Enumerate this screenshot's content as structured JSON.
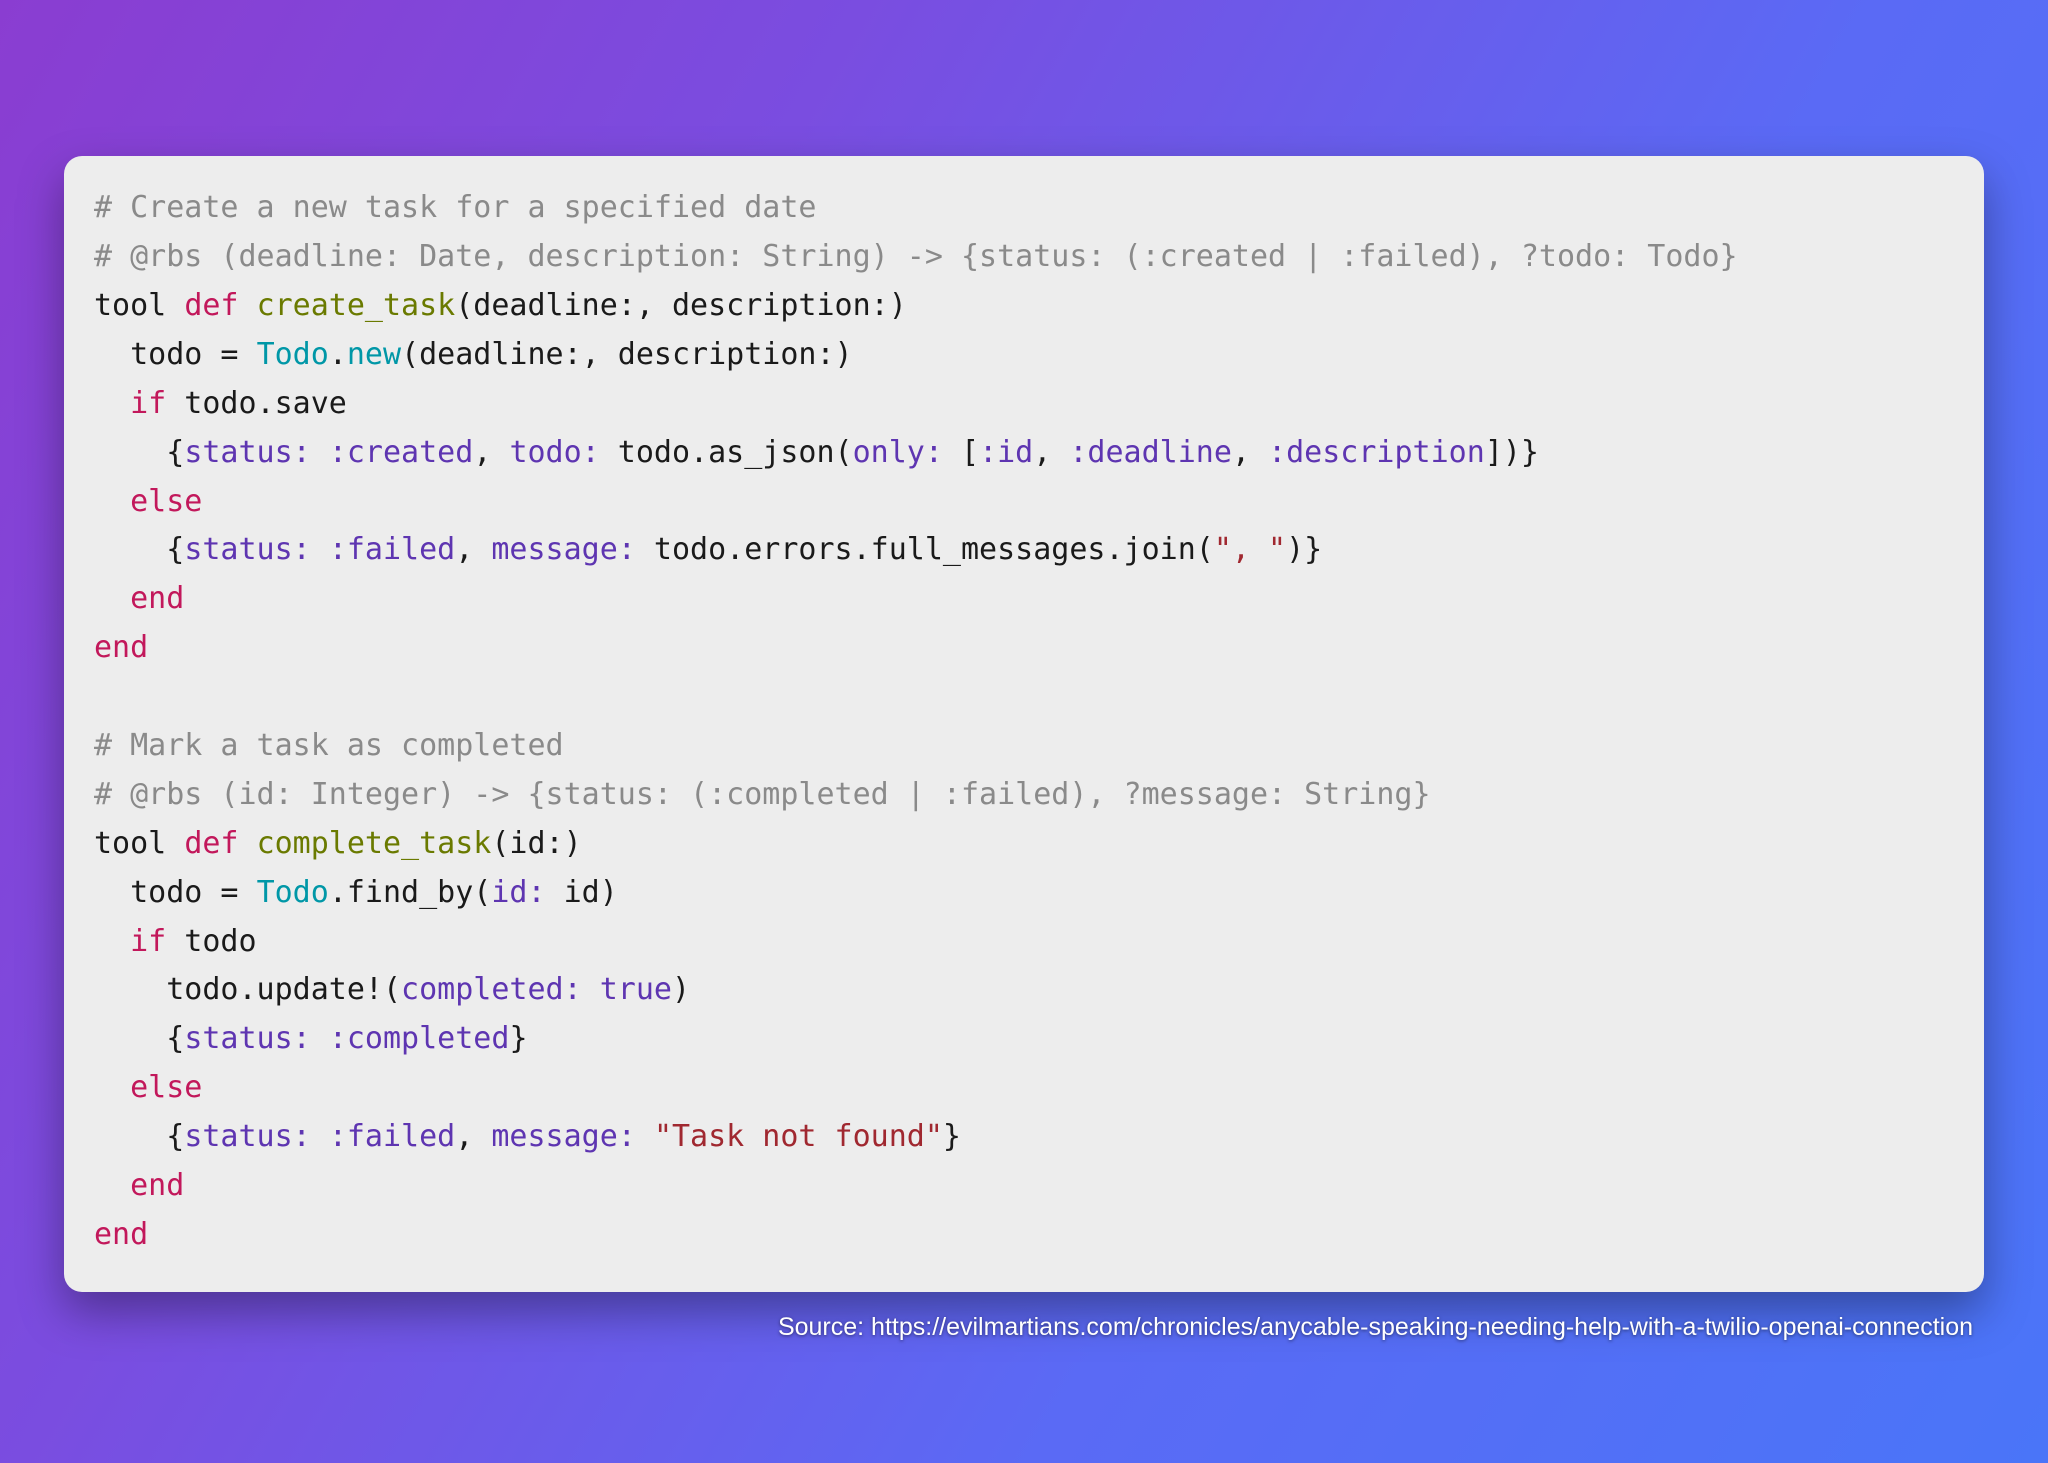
{
  "code": {
    "l1_comment": "# Create a new task for a specified date",
    "l2_comment": "# @rbs (deadline: Date, description: String) -> {status: (:created | :failed), ?todo: Todo}",
    "l3_tool": "tool",
    "l3_def": "def",
    "l3_fn": "create_task",
    "l3_rest": "(deadline:, description:)",
    "l4_pre": "  todo = ",
    "l4_class": "Todo",
    "l4_dot": ".",
    "l4_new": "new",
    "l4_rest": "(deadline:, description:)",
    "l5_pre": "  ",
    "l5_if": "if",
    "l5_rest": " todo.save",
    "l6_pre": "    {",
    "l6_k1": "status:",
    "l6_sp1": " ",
    "l6_v1": ":created",
    "l6_c1": ", ",
    "l6_k2": "todo:",
    "l6_mid": " todo.as_json(",
    "l6_k3": "only:",
    "l6_sp2": " [",
    "l6_s1": ":id",
    "l6_c2": ", ",
    "l6_s2": ":deadline",
    "l6_c3": ", ",
    "l6_s3": ":description",
    "l6_end": "])}",
    "l7_pre": "  ",
    "l7_else": "else",
    "l8_pre": "    {",
    "l8_k1": "status:",
    "l8_sp1": " ",
    "l8_v1": ":failed",
    "l8_c1": ", ",
    "l8_k2": "message:",
    "l8_mid": " todo.errors.full_messages.join(",
    "l8_str": "\", \"",
    "l8_end": ")}",
    "l9_pre": "  ",
    "l9_end": "end",
    "l10_end": "end",
    "blank": "",
    "l12_comment": "# Mark a task as completed",
    "l13_comment": "# @rbs (id: Integer) -> {status: (:completed | :failed), ?message: String}",
    "l14_tool": "tool",
    "l14_def": "def",
    "l14_fn": "complete_task",
    "l14_rest": "(id:)",
    "l15_pre": "  todo = ",
    "l15_class": "Todo",
    "l15_mid": ".find_by(",
    "l15_k": "id:",
    "l15_rest": " id)",
    "l16_pre": "  ",
    "l16_if": "if",
    "l16_rest": " todo",
    "l17_pre": "    todo.update!(",
    "l17_k": "completed:",
    "l17_sp": " ",
    "l17_v": "true",
    "l17_end": ")",
    "l18_pre": "    {",
    "l18_k": "status:",
    "l18_sp": " ",
    "l18_v": ":completed",
    "l18_end": "}",
    "l19_pre": "  ",
    "l19_else": "else",
    "l20_pre": "    {",
    "l20_k1": "status:",
    "l20_sp1": " ",
    "l20_v1": ":failed",
    "l20_c1": ", ",
    "l20_k2": "message:",
    "l20_sp2": " ",
    "l20_str": "\"Task not found\"",
    "l20_end": "}",
    "l21_pre": "  ",
    "l21_end": "end",
    "l22_end": "end"
  },
  "source": "Source: https://evilmartians.com/chronicles/anycable-speaking-needing-help-with-a-twilio-openai-connection"
}
